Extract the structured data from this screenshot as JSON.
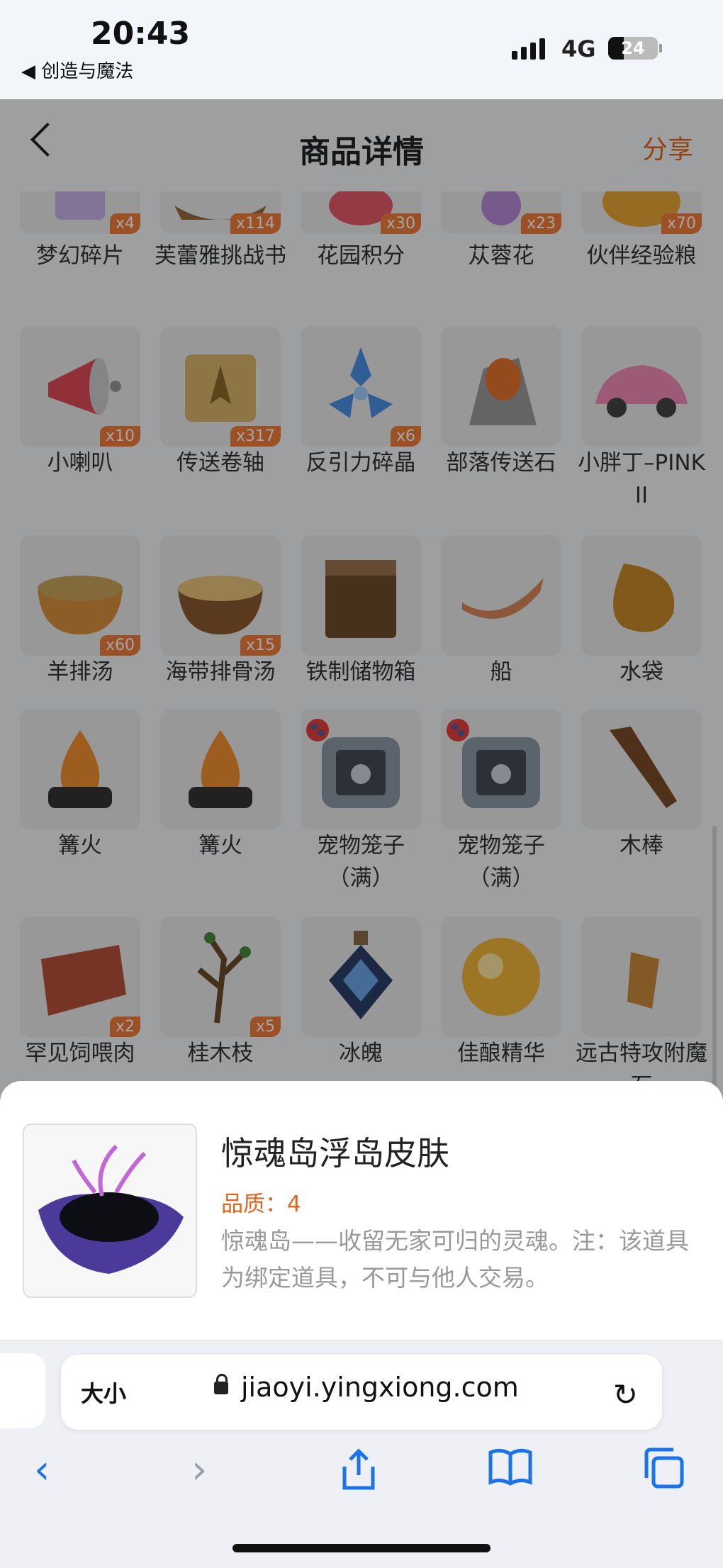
{
  "status": {
    "time": "20:43",
    "back_app": "◀ 创造与魔法",
    "network": "4G",
    "battery": "24"
  },
  "nav": {
    "title": "商品详情",
    "share": "分享"
  },
  "items": [
    {
      "label": "梦幻碎片",
      "qty": "x4"
    },
    {
      "label": "芙蕾雅挑战书",
      "qty": "x114"
    },
    {
      "label": "花园积分",
      "qty": "x30"
    },
    {
      "label": "苁蓉花",
      "qty": "x23"
    },
    {
      "label": "伙伴经验粮",
      "qty": "x70"
    },
    {
      "label": "小喇叭",
      "qty": "x10"
    },
    {
      "label": "传送卷轴",
      "qty": "x317"
    },
    {
      "label": "反引力碎晶",
      "qty": "x6"
    },
    {
      "label": "部落传送石",
      "qty": ""
    },
    {
      "label": "小胖丁–PINK II",
      "qty": ""
    },
    {
      "label": "羊排汤",
      "qty": "x60"
    },
    {
      "label": "海带排骨汤",
      "qty": "x15"
    },
    {
      "label": "铁制储物箱",
      "qty": ""
    },
    {
      "label": "船",
      "qty": ""
    },
    {
      "label": "水袋",
      "qty": ""
    },
    {
      "label": "篝火",
      "qty": ""
    },
    {
      "label": "篝火",
      "qty": ""
    },
    {
      "label": "宠物笼子（满）",
      "qty": ""
    },
    {
      "label": "宠物笼子（满）",
      "qty": ""
    },
    {
      "label": "木棒",
      "qty": ""
    },
    {
      "label": "罕见饲喂肉",
      "qty": "x2"
    },
    {
      "label": "桂木枝",
      "qty": "x5"
    },
    {
      "label": "冰魄",
      "qty": ""
    },
    {
      "label": "佳酿精华",
      "qty": ""
    },
    {
      "label": "远古特攻附魔石",
      "qty": ""
    }
  ],
  "detail": {
    "title": "惊魂岛浮岛皮肤",
    "quality": "品质：4",
    "description": "惊魂岛——收留无家可归的灵魂。注：该道具为绑定道具，不可与他人交易。"
  },
  "browser": {
    "text_size": "大小",
    "url": "jiaoyi.yingxiong.com"
  },
  "colors": {
    "accent": "#e0641c",
    "badge": "#ee7c3a",
    "safari_blue": "#1a73e8"
  }
}
